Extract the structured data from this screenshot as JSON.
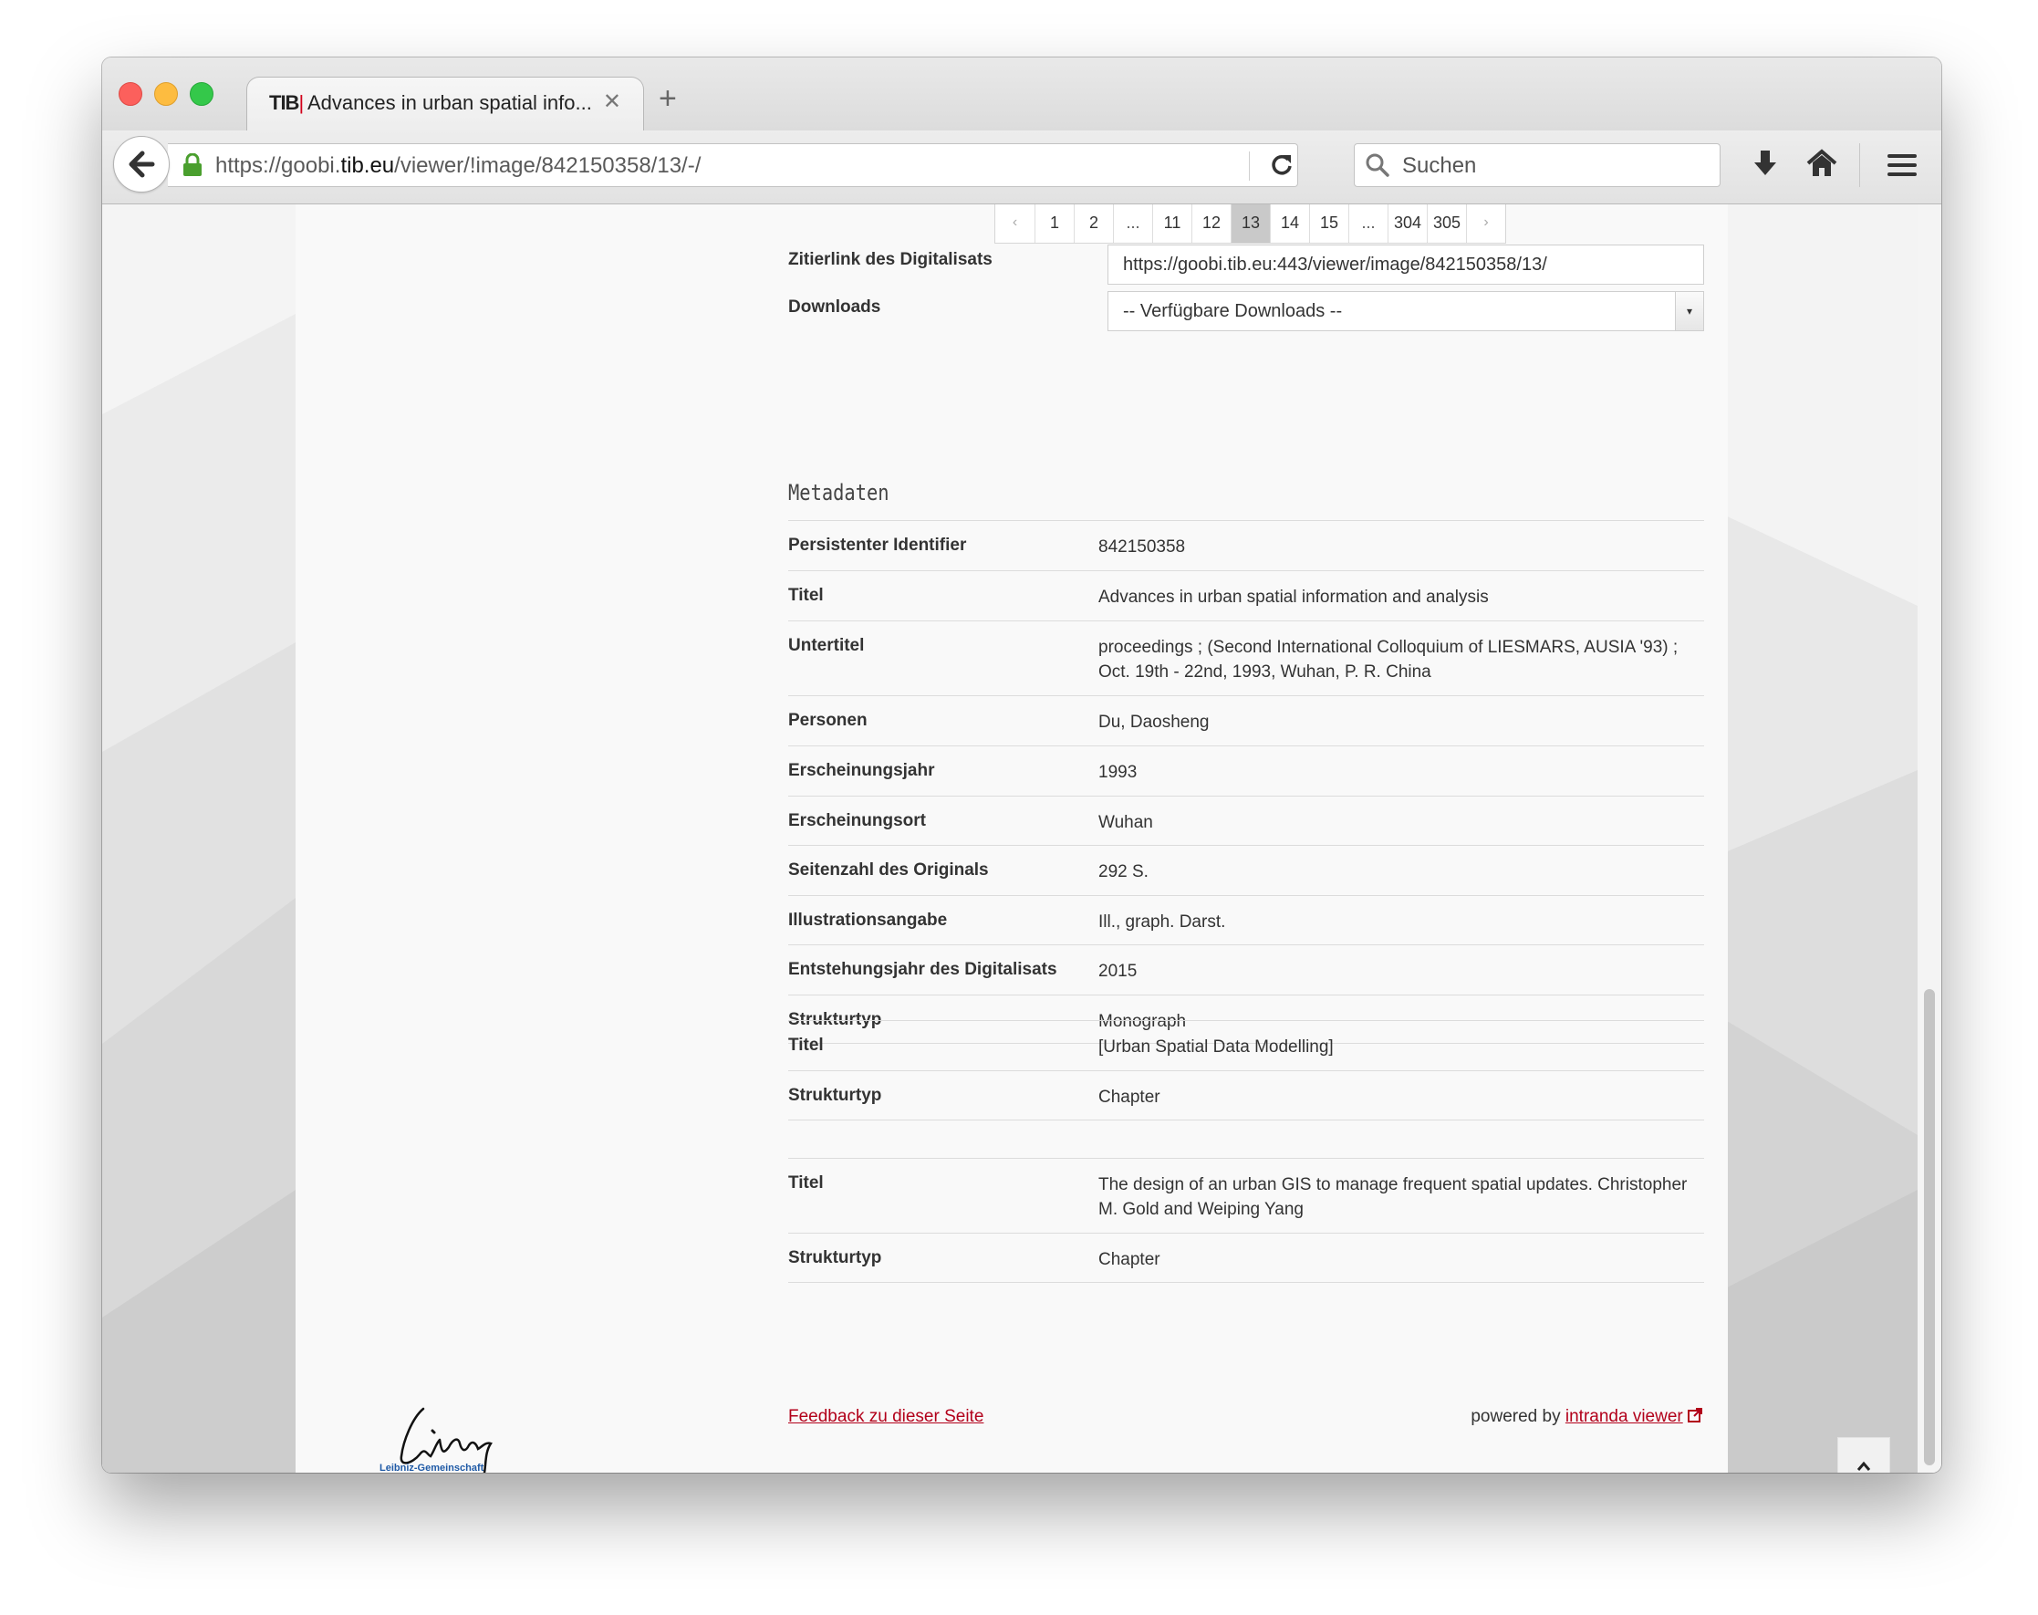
{
  "browser": {
    "tab": {
      "favicon_text": "TIB",
      "title": "Advances in urban spatial info...",
      "close_glyph": "✕"
    },
    "new_tab_glyph": "+",
    "url": {
      "scheme_prefix": "https://goobi.",
      "host": "tib.eu",
      "path": "/viewer/!image/842150358/13/-/"
    },
    "search_placeholder": "Suchen",
    "icons": [
      "back-arrow-icon",
      "lock-icon",
      "reload-icon",
      "search-icon",
      "download-icon",
      "home-icon",
      "hamburger-menu-icon"
    ]
  },
  "pagination": {
    "prev": "‹",
    "next": "›",
    "pages": [
      "1",
      "2",
      "...",
      "11",
      "12",
      "13",
      "14",
      "15",
      "...",
      "304",
      "305"
    ],
    "active": "13"
  },
  "citation": {
    "label": "Zitierlink des Digitalisats",
    "value": "https://goobi.tib.eu:443/viewer/image/842150358/13/"
  },
  "downloads": {
    "label": "Downloads",
    "selected": "-- Verfügbare Downloads --"
  },
  "metadata": {
    "heading": "Metadaten",
    "rows": [
      {
        "key": "Persistenter Identifier",
        "value": "842150358"
      },
      {
        "key": "Titel",
        "value": "Advances in urban spatial information and analysis"
      },
      {
        "key": "Untertitel",
        "value": "proceedings ; (Second International Colloquium of LIESMARS, AUSIA '93) ; Oct. 19th - 22nd, 1993, Wuhan, P. R. China"
      },
      {
        "key": "Personen",
        "value": "Du, Daosheng"
      },
      {
        "key": "Erscheinungsjahr",
        "value": "1993"
      },
      {
        "key": "Erscheinungsort",
        "value": "Wuhan"
      },
      {
        "key": "Seitenzahl des Originals",
        "value": "292 S."
      },
      {
        "key": "Illustrationsangabe",
        "value": "Ill., graph. Darst."
      },
      {
        "key": "Entstehungsjahr des Digitalisats",
        "value": "2015"
      },
      {
        "key": "Strukturtyp",
        "value": "Monograph"
      }
    ],
    "chapter1": [
      {
        "key": "Titel",
        "value": "[Urban Spatial Data Modelling]"
      },
      {
        "key": "Strukturtyp",
        "value": "Chapter"
      }
    ],
    "chapter2": [
      {
        "key": "Titel",
        "value": "The design of an urban GIS to manage frequent spatial updates. Christopher M. Gold and Weiping Yang"
      },
      {
        "key": "Strukturtyp",
        "value": "Chapter"
      }
    ]
  },
  "footer": {
    "feedback_link": "Feedback zu dieser Seite",
    "powered_by": "powered by",
    "viewer_link": "intranda viewer",
    "logo_caption": "Leibniz-Gemeinschaft"
  },
  "colors": {
    "accent_red": "#b2001a",
    "active_page": "#c9c9c9",
    "lock_green": "#4a9f2e"
  }
}
